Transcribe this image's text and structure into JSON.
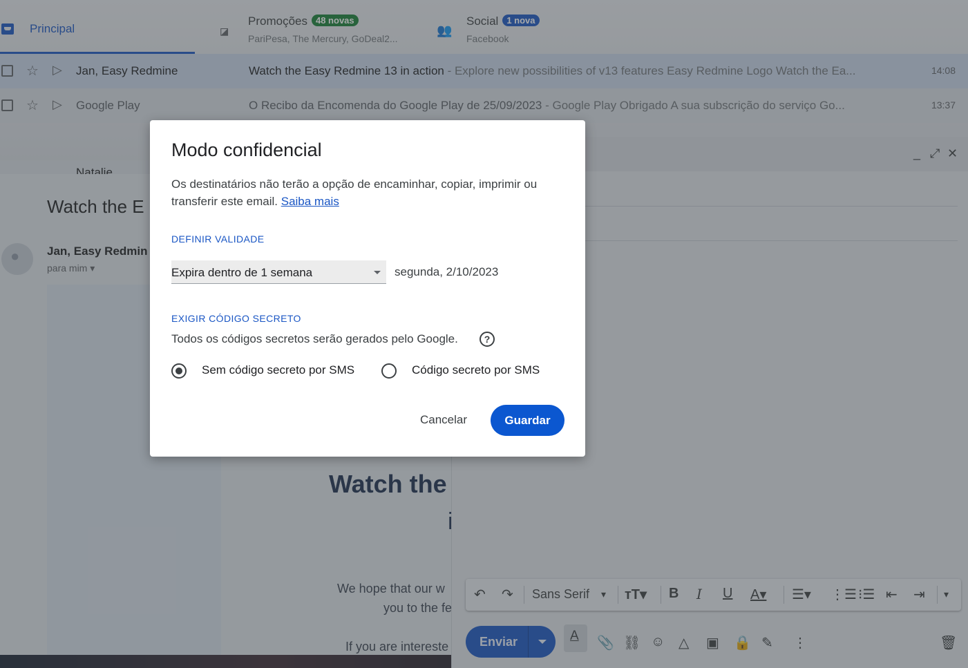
{
  "inbox": {
    "tabs": [
      {
        "label": "Principal"
      },
      {
        "label": "Promoções",
        "badge": "48 novas",
        "subtitle": "PariPesa, The Mercury, GoDeal2..."
      },
      {
        "label": "Social",
        "badge": "1 nova",
        "subtitle": "Facebook"
      }
    ],
    "rows": [
      {
        "sender": "Jan, Easy Redmine",
        "subject": "Watch the Easy Redmine 13 in action",
        "snippet": " - Explore new possibilities of v13 features Easy Redmine Logo Watch the Ea...",
        "time": "14:08"
      },
      {
        "sender": "Google Play",
        "subject": "O Recibo da Encomenda do Google Play de 25/09/2023",
        "snippet": " - Google Play Obrigado A sua subscrição do serviço Go...",
        "time": "13:37"
      },
      {
        "sender": "Natalie"
      }
    ]
  },
  "message": {
    "subject": "Watch the E",
    "from": "Jan, Easy Redmin",
    "to": "para mim",
    "body": {
      "heading": "Watch the",
      "heading2": "i",
      "p1": "We hope that our w",
      "p2": "you to the fe",
      "p3": "If you are intereste"
    }
  },
  "compose": {
    "font_name": "Sans Serif",
    "send_label": "Enviar"
  },
  "dialog": {
    "title": "Modo confidencial",
    "description": "Os destinatários não terão a opção de encaminhar, copiar, imprimir ou transferir este email.",
    "learn_more": "Saiba mais",
    "expiry_heading": "DEFINIR VALIDADE",
    "expiry_selected": "Expira dentro de 1 semana",
    "expiry_date": "segunda, 2/10/2023",
    "passcode_heading": "EXIGIR CÓDIGO SECRETO",
    "passcode_info": "Todos os códigos secretos serão gerados pelo Google.",
    "option_no_sms": "Sem código secreto por SMS",
    "option_sms": "Código secreto por SMS",
    "selected_option": "option_no_sms",
    "cancel_label": "Cancelar",
    "save_label": "Guardar"
  },
  "colors": {
    "accent": "#1a56c4",
    "save_button": "#0b57d0",
    "promo_badge": "#188038"
  }
}
